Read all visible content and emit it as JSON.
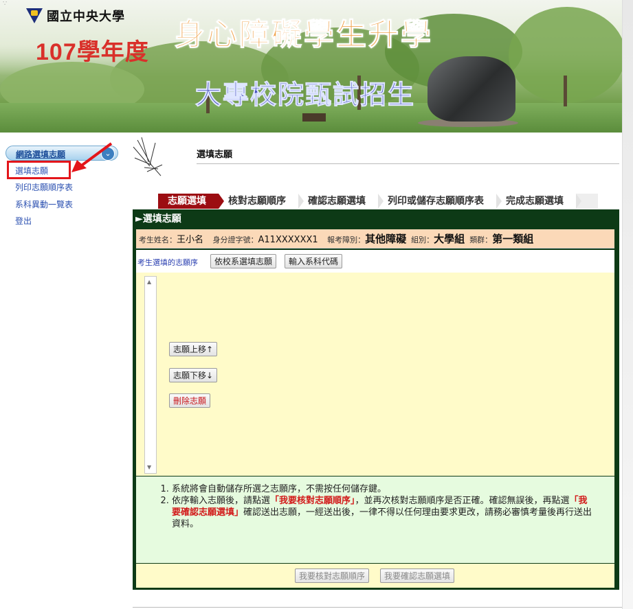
{
  "banner": {
    "university": "國立中央大學",
    "year": "107學年度",
    "title_main": "身心障礙學生升學",
    "title_sub": "大專校院甄試招生"
  },
  "sidebar": {
    "header": "網路選填志願",
    "items": [
      {
        "label": "選填志願"
      },
      {
        "label": "列印志願順序表"
      },
      {
        "label": "系科異動一覽表"
      },
      {
        "label": "登出"
      }
    ]
  },
  "page": {
    "title": "選填志願"
  },
  "steps": [
    {
      "label": "志願選填",
      "active": true
    },
    {
      "label": "核對志願順序",
      "active": false
    },
    {
      "label": "確認志願選填",
      "active": false
    },
    {
      "label": "列印或儲存志願順序表",
      "active": false
    },
    {
      "label": "完成志願選填",
      "active": false
    }
  ],
  "panel": {
    "heading": "選填志願",
    "info": {
      "name_label": "考生姓名：",
      "name": "王小名",
      "id_label": "身分證字號：",
      "id": "A11XXXXXX1",
      "category_label": "報考障別：",
      "category": "其他障礙",
      "group_label": "組別：",
      "group": "大學組",
      "cluster_label": "類群：",
      "cluster": "第一類組"
    },
    "toolbar": {
      "label": "考生選填的志願序",
      "by_school": "依校系選填志願",
      "enter_code": "輸入系科代碼"
    },
    "buttons": {
      "move_up": "志願上移↑",
      "move_down": "志願下移↓",
      "delete": "刪除志願"
    },
    "notes": {
      "n1": "系統將會自動儲存所選之志願序，不需按任何儲存鍵。",
      "n2_a": "依序輸入志願後，請點選",
      "n2_hl1": "「我要核對志願順序」",
      "n2_b": "，並再次核對志願順序是否正確。確認無誤後，再點選",
      "n2_hl2": "「我要確認志願選填」",
      "n2_c": "確認送出志願，一經送出後，一律不得以任何理由要求更改，請務必審慎考量後再行送出資料。"
    },
    "actions": {
      "check_order": "我要核對志願順序",
      "confirm": "我要確認志願選填"
    }
  },
  "colors": {
    "accent": "#9c0d12",
    "panel_bg": "#0d3a16",
    "highlight_red": "#d21a1a"
  }
}
